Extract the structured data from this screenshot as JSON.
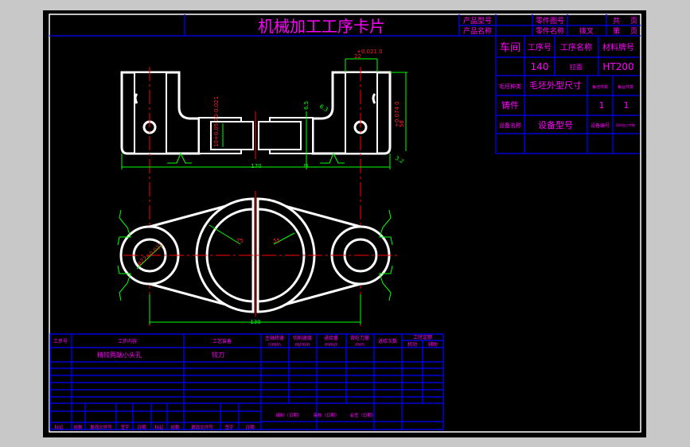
{
  "title": "机械加工工序卡片",
  "header": {
    "product_model_label": "产品型号",
    "product_name_label": "产品名称",
    "part_drawing_no_label": "零件图号",
    "part_name_label": "零件名称",
    "part_name_value": "拨叉",
    "total_label": "共",
    "page_label": "页",
    "sheet_label": "第",
    "sheet_page_label": "页"
  },
  "info_table": {
    "workshop_label": "车间",
    "op_no_label": "工序号",
    "op_name_label": "工序名称",
    "material_label": "材料牌号",
    "op_no_value": "140",
    "op_name_value": "拉面",
    "material_value": "HT200",
    "blank_type_label": "毛坯种类",
    "blank_size_label": "毛坯外型尺寸",
    "blank_pieces_label": "每坯件数",
    "pieces_per_unit_label": "每台件数",
    "blank_type_value": "铸件",
    "blank_pieces_value": "1",
    "pieces_per_unit_value": "1",
    "equipment_name_label": "设备名称",
    "equipment_model_label": "设备型号",
    "equipment_no_label": "设备编号",
    "concurrent_label": "同时加工件数"
  },
  "drawing": {
    "dims": {
      "width_top": "22",
      "tol_top": "+0.021 0",
      "height_right": "58",
      "tol_right": "+0.074 0",
      "dim_65": "6.5",
      "dim_3": "3",
      "slot": "10+0.05 20-0.021",
      "overall_top": "170",
      "hole_dia": "φ22+0.021",
      "r_left": "75",
      "r_right": "55",
      "overall_bottom": "130",
      "rough_a": "6.3",
      "rough_b": "3.2"
    }
  },
  "process_table": {
    "headers": {
      "step_no": "工步号",
      "step_content": "工步内容",
      "equipment": "工艺装备",
      "spindle_speed": "主轴转速",
      "spindle_unit": "r/min",
      "cut_speed": "切削速度",
      "cut_speed_unit": "m/min",
      "feed": "进给量",
      "feed_unit": "mm/r",
      "depth": "背吃刀量",
      "depth_unit": "mm",
      "passes": "进给次数",
      "time_quota": "工时定额",
      "machine_time": "机动",
      "aux_time": "辅助"
    },
    "rows": [
      {
        "step_content": "精铰两端小头孔",
        "equipment": "铰刀"
      }
    ],
    "footer": {
      "mark": "标记",
      "count": "处数",
      "change_doc": "更改文件号",
      "signature": "签字",
      "date": "日期",
      "compiled": "编制（日期）",
      "reviewed": "审核（日期）",
      "countersigned": "会签（日期）"
    }
  }
}
